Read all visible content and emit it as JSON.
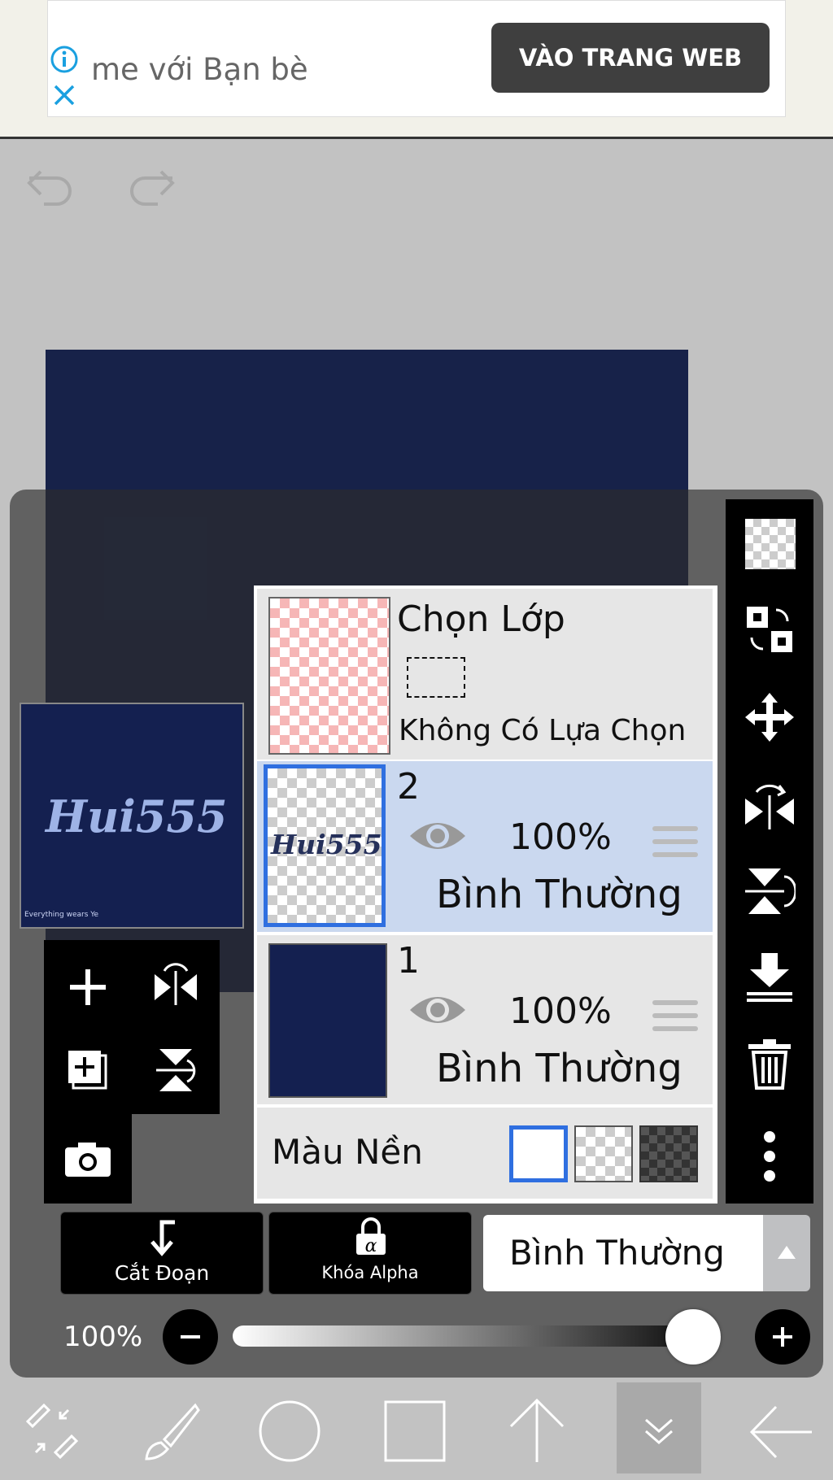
{
  "ad": {
    "text": "me với Bạn bè",
    "button_label": "VÀO TRANG WEB"
  },
  "canvas": {
    "color": "#172249"
  },
  "preview": {
    "artwork_text": "Hui555",
    "credit": "Everything wears Ye"
  },
  "layers": {
    "selection": {
      "title": "Chọn Lớp",
      "subtitle": "Không Có Lựa Chọn"
    },
    "items": [
      {
        "name": "2",
        "opacity": "100%",
        "blend": "Bình Thường",
        "thumb_text": "Hui555",
        "selected": true
      },
      {
        "name": "1",
        "opacity": "100%",
        "blend": "Bình Thường",
        "selected": false
      }
    ],
    "background": {
      "label": "Màu Nền",
      "options": [
        "white",
        "transparent",
        "dark"
      ],
      "selected": "white"
    }
  },
  "bottom": {
    "clip_label": "Cắt Đoạn",
    "alpha_lock_label": "Khóa Alpha",
    "blend_mode": "Bình Thường",
    "opacity_label": "100%",
    "opacity_value": 1.0
  },
  "icons": {
    "left_tools": [
      "add-layer-icon",
      "flip-horizontal-icon",
      "add-copy-layer-icon",
      "flip-vertical-icon",
      "camera-icon"
    ],
    "right_tools": [
      "transparency-icon",
      "swap-icon",
      "move-icon",
      "flip-h-rotate-icon",
      "flip-v-rotate-icon",
      "merge-down-icon",
      "delete-icon",
      "more-icon"
    ],
    "nav": [
      "transform-icon",
      "brush-icon",
      "circle-icon",
      "square-icon",
      "arrow-up-icon",
      "chevron-down-icon",
      "arrow-left-icon"
    ]
  },
  "colors": {
    "accent": "#2f6fe0",
    "selected_row": "#cad8ef",
    "canvas": "#172249"
  }
}
